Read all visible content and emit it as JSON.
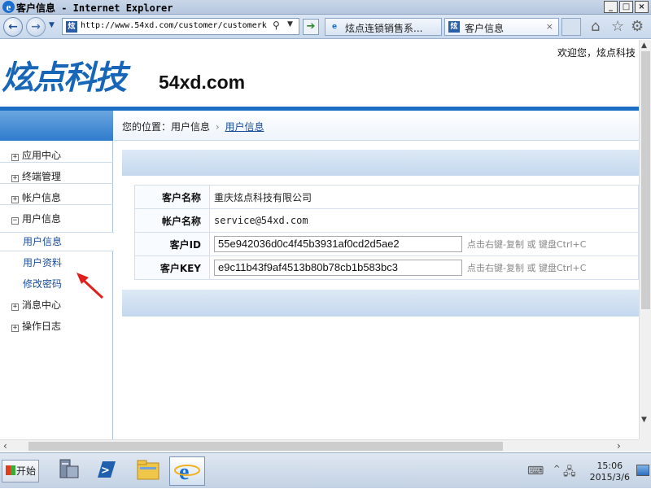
{
  "window": {
    "title": "客户信息 - Internet Explorer",
    "controls": [
      "_",
      "□",
      "×"
    ]
  },
  "browser": {
    "back_icon": "back-arrow-icon",
    "forward_icon": "forward-arrow-icon",
    "favicon_text": "炫",
    "address": "http://www.54xd.com/customer/customerk",
    "tabs": [
      {
        "label": "炫点连锁销售系...",
        "close": ""
      },
      {
        "label": "客户信息",
        "close": "×"
      }
    ],
    "toolbar_icons": [
      "home-icon",
      "favorites-star-icon",
      "settings-gear-icon"
    ]
  },
  "site": {
    "logo": "炫点科技",
    "domain": "54xd.com",
    "welcome": "欢迎您，炫点科技"
  },
  "breadcrumb": {
    "prefix": "您的位置：",
    "section": "用户信息",
    "sep": "›",
    "current": "用户信息"
  },
  "sidebar": {
    "items": [
      {
        "label": "应用中心",
        "toggle": "+"
      },
      {
        "label": "终端管理",
        "toggle": "+"
      },
      {
        "label": "帐户信息",
        "toggle": "+"
      },
      {
        "label": "用户信息",
        "toggle": "−"
      }
    ],
    "subitems": [
      {
        "label": "用户信息"
      },
      {
        "label": "用户资料"
      },
      {
        "label": "修改密码"
      }
    ],
    "more_items": [
      {
        "label": "消息中心",
        "toggle": "+"
      },
      {
        "label": "操作日志",
        "toggle": "+"
      }
    ]
  },
  "info_table": {
    "rows": [
      {
        "key": "客户名称",
        "value": "重庆炫点科技有限公司"
      },
      {
        "key": "帐户名称",
        "value": "service@54xd.com"
      },
      {
        "key": "客户ID",
        "value": "55e942036d0c4f45b3931af0cd2d5ae2",
        "hint": "点击右键-复制 或 键盘Ctrl+C"
      },
      {
        "key": "客户KEY",
        "value": "e9c11b43f9af4513b80b78cb1b583bc3",
        "hint": "点击右键-复制 或 键盘Ctrl+C"
      }
    ]
  },
  "taskbar": {
    "start_label": "开始",
    "clock_time": "15:06",
    "clock_date": "2015/3/6"
  },
  "colors": {
    "brand_blue": "#1766b8",
    "accent_bar": "#1b6ec4",
    "arrow_red": "#e0201c"
  }
}
